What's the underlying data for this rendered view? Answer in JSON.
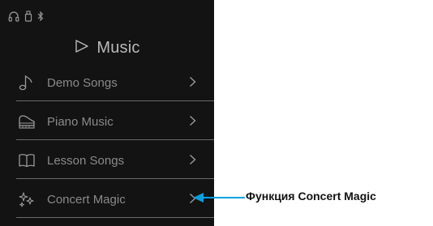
{
  "header": {
    "title": "Music",
    "icon": "play-outline-icon"
  },
  "status_icons": [
    "headphones-icon",
    "usb-memory-icon",
    "bluetooth-icon"
  ],
  "menu": {
    "items": [
      {
        "label": "Demo Songs",
        "icon": "music-note-icon"
      },
      {
        "label": "Piano Music",
        "icon": "grand-piano-icon"
      },
      {
        "label": "Lesson Songs",
        "icon": "open-book-icon"
      },
      {
        "label": "Concert Magic",
        "icon": "sparkles-icon"
      }
    ]
  },
  "callout": {
    "text": "Функция Concert Magic",
    "color": "#00a0e3"
  },
  "colors": {
    "screen_background": "#131313",
    "text": "#8a8a8a",
    "divider": "#6a6a6a"
  }
}
